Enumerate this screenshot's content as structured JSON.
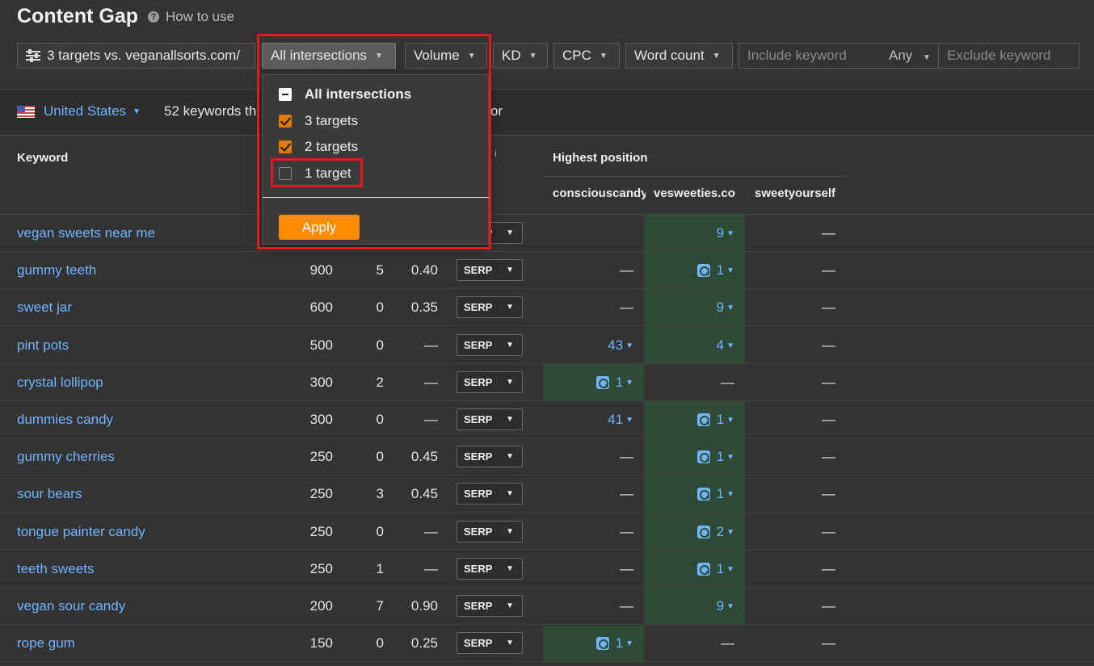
{
  "header": {
    "title": "Content Gap",
    "help_label": "How to use",
    "help_icon": "question-circle-icon"
  },
  "toolbar": {
    "targets_label": "3 targets vs. veganallsorts.com/",
    "intersections_label": "All intersections",
    "volume_label": "Volume",
    "kd_label": "KD",
    "cpc_label": "CPC",
    "word_count_label": "Word count",
    "include_placeholder": "Include keyword",
    "any_label": "Any",
    "exclude_placeholder": "Exclude keyword"
  },
  "subbar": {
    "country": "United States",
    "keywords_text": "52 keywords th",
    "keywords_tail": "or"
  },
  "table": {
    "keyword_header": "Keyword",
    "info_mark": "i",
    "highest_position_header": "Highest position",
    "domains": [
      "consciouscandy",
      "vesweeties.co",
      "sweetyourself"
    ],
    "rows": [
      {
        "keyword": "vegan sweets near me",
        "volume": "",
        "kd": "",
        "cpc": "",
        "serp": "SERP",
        "p1": "",
        "p2": "9",
        "p3": "—"
      },
      {
        "keyword": "gummy teeth",
        "volume": "900",
        "kd": "5",
        "cpc": "0.40",
        "serp": "SERP",
        "p1": "—",
        "p2": "1",
        "p3": "—"
      },
      {
        "keyword": "sweet jar",
        "volume": "600",
        "kd": "0",
        "cpc": "0.35",
        "serp": "SERP",
        "p1": "—",
        "p2": "9",
        "p3": "—"
      },
      {
        "keyword": "pint pots",
        "volume": "500",
        "kd": "0",
        "cpc": "—",
        "serp": "SERP",
        "p1": "43",
        "p2": "4",
        "p3": "—"
      },
      {
        "keyword": "crystal lollipop",
        "volume": "300",
        "kd": "2",
        "cpc": "—",
        "serp": "SERP",
        "p1": "1",
        "p2": "—",
        "p3": "—"
      },
      {
        "keyword": "dummies candy",
        "volume": "300",
        "kd": "0",
        "cpc": "—",
        "serp": "SERP",
        "p1": "41",
        "p2": "1",
        "p3": "—"
      },
      {
        "keyword": "gummy cherries",
        "volume": "250",
        "kd": "0",
        "cpc": "0.45",
        "serp": "SERP",
        "p1": "—",
        "p2": "1",
        "p3": "—"
      },
      {
        "keyword": "sour bears",
        "volume": "250",
        "kd": "3",
        "cpc": "0.45",
        "serp": "SERP",
        "p1": "—",
        "p2": "1",
        "p3": "—"
      },
      {
        "keyword": "tongue painter candy",
        "volume": "250",
        "kd": "0",
        "cpc": "—",
        "serp": "SERP",
        "p1": "—",
        "p2": "2",
        "p3": "—"
      },
      {
        "keyword": "teeth sweets",
        "volume": "250",
        "kd": "1",
        "cpc": "—",
        "serp": "SERP",
        "p1": "—",
        "p2": "1",
        "p3": "—"
      },
      {
        "keyword": "vegan sour candy",
        "volume": "200",
        "kd": "7",
        "cpc": "0.90",
        "serp": "SERP",
        "p1": "—",
        "p2": "9",
        "p3": "—"
      },
      {
        "keyword": "rope gum",
        "volume": "150",
        "kd": "0",
        "cpc": "0.25",
        "serp": "SERP",
        "p1": "1",
        "p2": "—",
        "p3": "—"
      }
    ]
  },
  "dropdown": {
    "all_label": "All intersections",
    "three_label": "3 targets",
    "two_label": "2 targets",
    "one_label": "1 target",
    "apply_label": "Apply",
    "three_checked": true,
    "two_checked": true,
    "one_checked": false
  },
  "colors": {
    "accent": "#ff8c00",
    "link": "#6fb5ff",
    "highlight": "#e8191c",
    "green_col": "#2e4a36"
  }
}
